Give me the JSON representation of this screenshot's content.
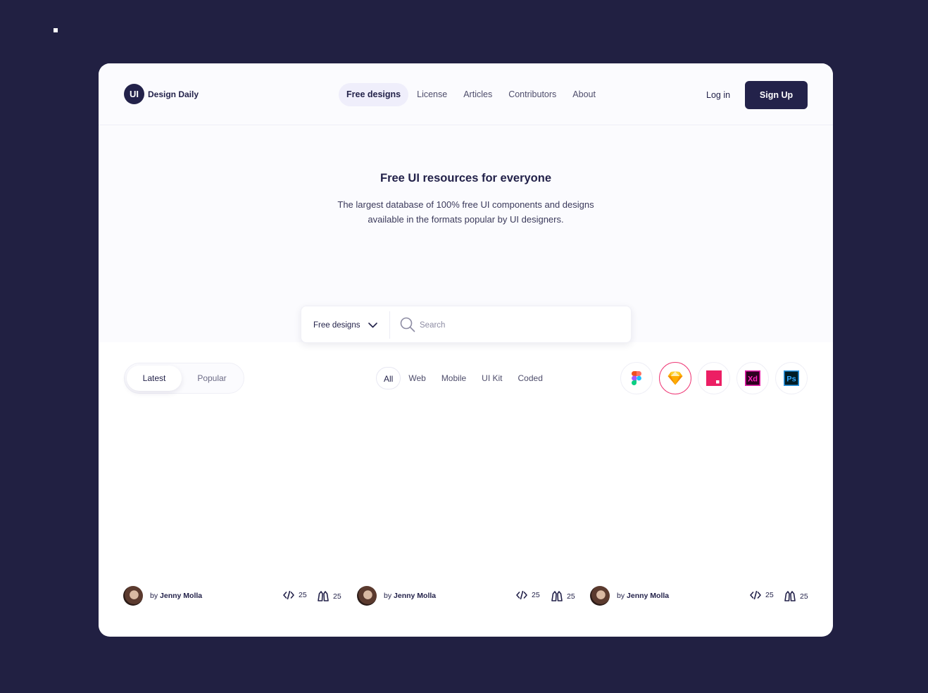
{
  "brand": {
    "badge": "UI",
    "name": "Design Daily"
  },
  "nav": {
    "items": [
      {
        "label": "Free designs",
        "active": true
      },
      {
        "label": "License",
        "active": false
      },
      {
        "label": "Articles",
        "active": false
      },
      {
        "label": "Contributors",
        "active": false
      },
      {
        "label": "About",
        "active": false
      }
    ],
    "login_label": "Log in",
    "signup_label": "Sign Up"
  },
  "hero": {
    "title": "Free UI resources for everyone",
    "subtitle_line1": "The largest database of 100% free UI components and designs",
    "subtitle_line2": "available in the formats popular by UI designers."
  },
  "search": {
    "filter_value": "Free designs",
    "placeholder": "Search",
    "value": ""
  },
  "sort": {
    "latest": "Latest",
    "popular": "Popular",
    "selected": "Latest"
  },
  "categories": [
    {
      "label": "All",
      "active": true
    },
    {
      "label": "Web",
      "active": false
    },
    {
      "label": "Mobile",
      "active": false
    },
    {
      "label": "UI Kit",
      "active": false
    },
    {
      "label": "Coded",
      "active": false
    }
  ],
  "tools": [
    {
      "name": "figma-icon",
      "selected": false
    },
    {
      "name": "sketch-icon",
      "selected": true
    },
    {
      "name": "invision-studio-icon",
      "selected": false
    },
    {
      "name": "adobe-xd-icon",
      "selected": false,
      "text": "Xd"
    },
    {
      "name": "photoshop-icon",
      "selected": false,
      "text": "Ps"
    }
  ],
  "colors": {
    "background": "#212042",
    "primary": "#23224a",
    "accent_pink": "#ef3b78",
    "hero_bg": "#fbfbfe"
  },
  "cards": [
    {
      "by": "by",
      "author": "Jenny Molla",
      "code_count": "25",
      "likes": "25"
    },
    {
      "by": "by",
      "author": "Jenny Molla",
      "code_count": "25",
      "likes": "25"
    },
    {
      "by": "by",
      "author": "Jenny Molla",
      "code_count": "25",
      "likes": "25"
    }
  ]
}
